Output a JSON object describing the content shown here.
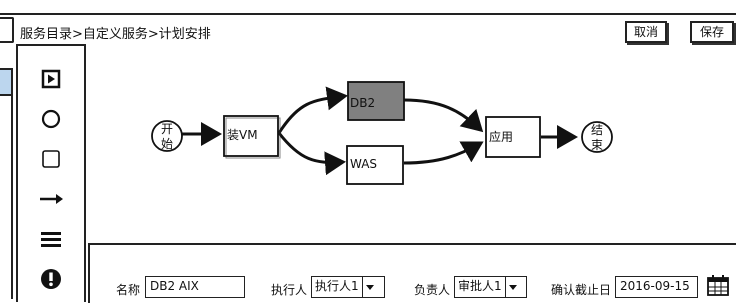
{
  "breadcrumb": {
    "text": "服务目录>自定义服务>计划安排"
  },
  "toolbar": {
    "cancel_label": "取消",
    "save_label": "保存"
  },
  "palette": {
    "items": [
      {
        "name": "play-icon"
      },
      {
        "name": "circle-icon"
      },
      {
        "name": "square-icon"
      },
      {
        "name": "arrow-right-icon"
      },
      {
        "name": "menu-lines-icon"
      },
      {
        "name": "exclamation-icon"
      }
    ]
  },
  "flow": {
    "start": {
      "line1": "开",
      "line2": "始"
    },
    "install_vm": "装VM",
    "db2": "DB2",
    "was": "WAS",
    "app": "应用",
    "end": {
      "line1": "结",
      "line2": "束"
    },
    "selected_node_color": "#808080"
  },
  "properties": {
    "name_label": "名称",
    "name_value": "DB2  AIX",
    "executor_label": "执行人",
    "executor_value": "执行人1",
    "owner_label": "负责人",
    "owner_value": "审批人1",
    "deadline_label": "确认截止日",
    "deadline_value": "2016-09-15"
  }
}
